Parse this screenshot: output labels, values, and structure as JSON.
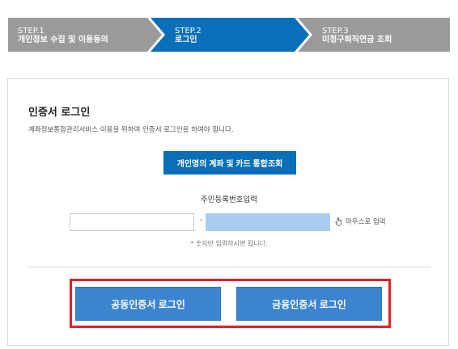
{
  "steps": [
    {
      "step": "STEP.1",
      "label": "개인정보 수집 및 이용동의",
      "state": "done",
      "color": "#9a9a9a"
    },
    {
      "step": "STEP.2",
      "label": "로그인",
      "state": "current",
      "color": "#0a6fb8"
    },
    {
      "step": "STEP.3",
      "label": "미청구퇴직연금 조회",
      "state": "pending",
      "color": "#9a9a9a"
    }
  ],
  "login": {
    "title": "인증서 로그인",
    "description": "계좌정보통합관리서비스 이용을 위하여 인증서 로그인을 하여야 합니다.",
    "inquiry_button": "개인명의 계좌 및 카드 통합조회",
    "resident_label": "주민등록번호입력",
    "resident_front_value": "",
    "resident_separator": "-",
    "resident_back_value": "",
    "mouse_input_label": "마우스로 입력",
    "hint": "* 숫자만 입력하시면 됩니다.",
    "common_cert_button": "공동인증서 로그인",
    "finance_cert_button": "금융인증서 로그인"
  },
  "colors": {
    "accent": "#0a6fb8",
    "button": "#3d84cf",
    "highlight": "#e2202b",
    "step_inactive": "#9a9a9a"
  },
  "icons": {
    "mouse_input": "hand-pointer-icon"
  }
}
